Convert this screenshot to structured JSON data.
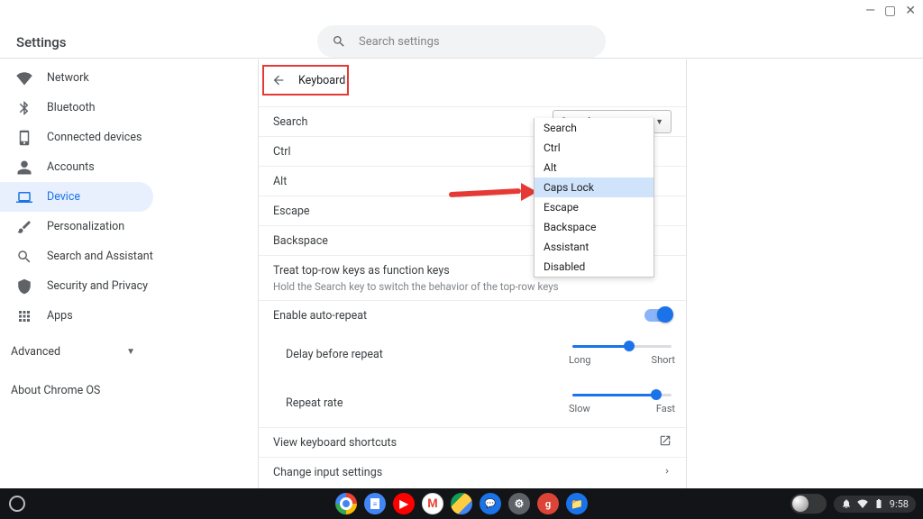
{
  "appTitle": "Settings",
  "search": {
    "placeholder": "Search settings"
  },
  "sidebar": {
    "items": [
      {
        "label": "Network"
      },
      {
        "label": "Bluetooth"
      },
      {
        "label": "Connected devices"
      },
      {
        "label": "Accounts"
      },
      {
        "label": "Device"
      },
      {
        "label": "Personalization"
      },
      {
        "label": "Search and Assistant"
      },
      {
        "label": "Security and Privacy"
      },
      {
        "label": "Apps"
      }
    ],
    "advanced": "Advanced",
    "about": "About Chrome OS"
  },
  "page": {
    "title": "Keyboard",
    "rows": {
      "search": "Search",
      "ctrl": "Ctrl",
      "alt": "Alt",
      "escape": "Escape",
      "backspace": "Backspace",
      "fnkeys": {
        "title": "Treat top-row keys as function keys",
        "sub": "Hold the Search key to switch the behavior of the top-row keys"
      },
      "autorepeat": "Enable auto-repeat",
      "delay": {
        "title": "Delay before repeat",
        "l": "Long",
        "r": "Short"
      },
      "rate": {
        "title": "Repeat rate",
        "l": "Slow",
        "r": "Fast"
      },
      "shortcuts": "View keyboard shortcuts",
      "input": "Change input settings"
    },
    "dropdown": {
      "selected": "Search",
      "options": [
        "Search",
        "Ctrl",
        "Alt",
        "Caps Lock",
        "Escape",
        "Backspace",
        "Assistant",
        "Disabled"
      ],
      "highlighted": "Caps Lock"
    }
  },
  "shelf": {
    "apps": [
      "chrome",
      "docs",
      "youtube",
      "gmail",
      "drive",
      "messages",
      "settings",
      "g-plus",
      "files"
    ],
    "clock": "9:58"
  }
}
